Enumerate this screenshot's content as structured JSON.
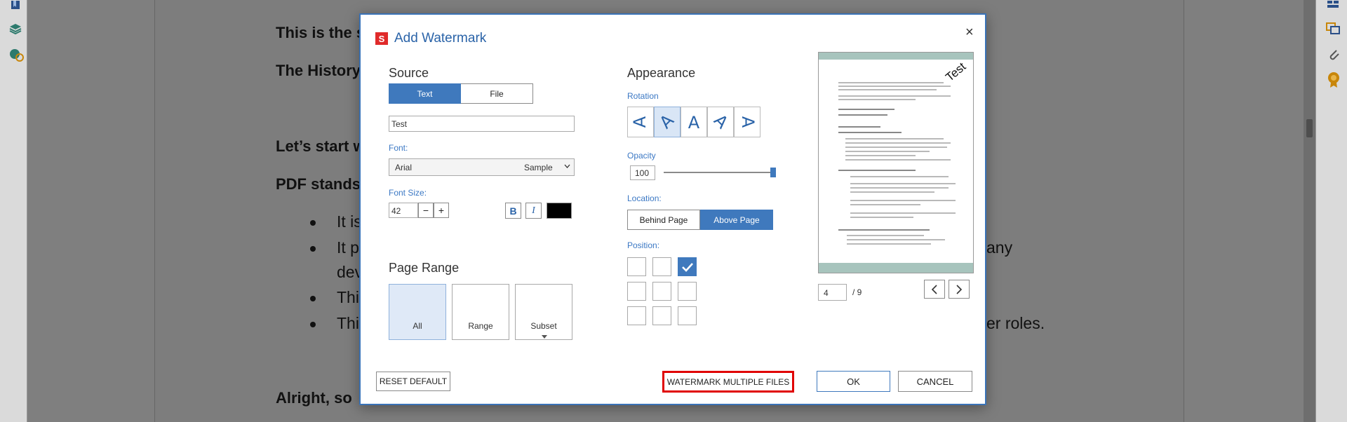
{
  "document": {
    "lines": [
      {
        "text": "This is the s",
        "style": "bold"
      },
      {
        "text": "The History",
        "style": "bold"
      },
      {
        "text": "Let’s start w",
        "style": "bold"
      },
      {
        "text": "PDF stands",
        "style": "bold"
      }
    ],
    "bullets": [
      {
        "text": "It is"
      },
      {
        "text": "It p"
      },
      {
        "text": "Thi"
      },
      {
        "text": "Thi"
      }
    ],
    "bullet_continuation": "dev",
    "right_fragments": [
      "any",
      "er roles."
    ],
    "bottom_line": "Alright, so "
  },
  "dialog": {
    "app_icon": "S",
    "title": "Add Watermark",
    "close_glyph": "×",
    "source": {
      "heading": "Source",
      "tabs": [
        "Text",
        "File"
      ],
      "selected_tab": "Text",
      "text_value": "Test",
      "font_label": "Font:",
      "font_value": "Arial",
      "font_sample": "Sample",
      "font_size_label": "Font Size:",
      "font_size_value": "42",
      "minus": "−",
      "plus": "+",
      "bold": "B",
      "italic": "I",
      "color": "#000000"
    },
    "page_range": {
      "heading": "Page Range",
      "options": [
        "All",
        "Range",
        "Subset"
      ],
      "selected": "All"
    },
    "appearance": {
      "heading": "Appearance",
      "rotation_label": "Rotation",
      "rotation_selected_index": 1,
      "rotation_glyph": "A",
      "opacity_label": "Opacity",
      "opacity_value": "100",
      "opacity_fraction": 1.0,
      "location_label": "Location:",
      "location_options": [
        "Behind Page",
        "Above Page"
      ],
      "location_selected": "Above Page",
      "position_label": "Position:",
      "position_selected": "top-right"
    },
    "preview": {
      "watermark_text": "Test",
      "page_value": "4",
      "page_total": "/ 9",
      "prev_glyph": "<",
      "next_glyph": ">"
    },
    "buttons": {
      "reset": "RESET DEFAULT",
      "multiple": "WATERMARK MULTIPLE FILES",
      "ok": "OK",
      "cancel": "CANCEL"
    },
    "colors": {
      "accent": "#3f79bd",
      "title": "#2a63a8",
      "highlight": "#e00000"
    }
  }
}
